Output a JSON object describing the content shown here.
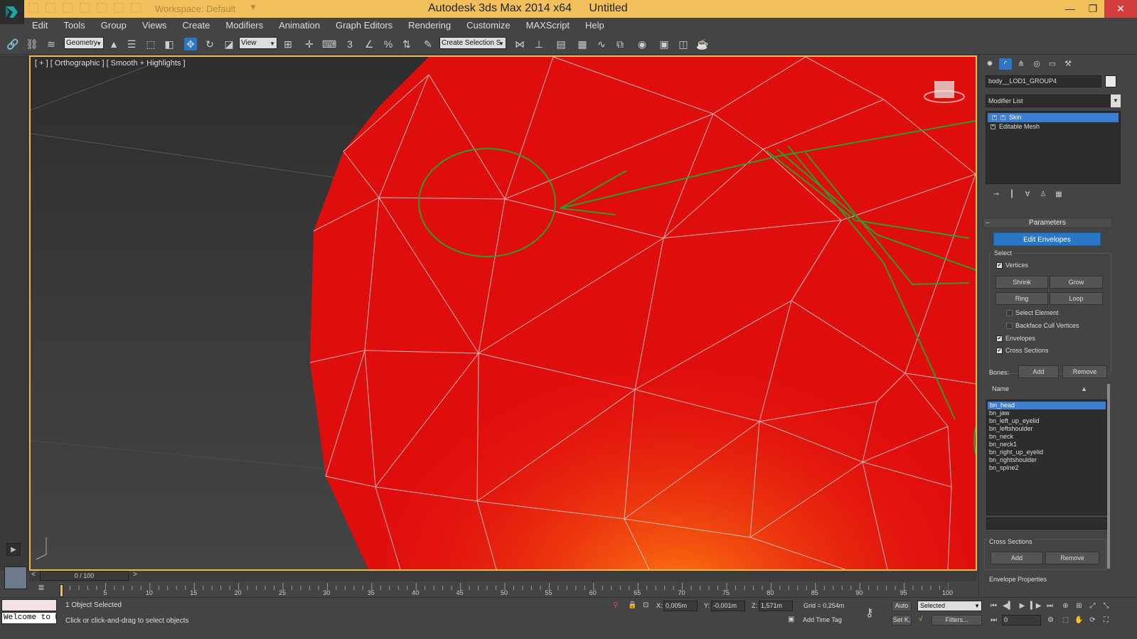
{
  "window": {
    "workspace_label": "Workspace: Default",
    "app_title": "Autodesk 3ds Max  2014 x64",
    "doc_title": "Untitled",
    "minimize": "—",
    "maximize": "❐",
    "close": "✕"
  },
  "menu": [
    "Edit",
    "Tools",
    "Group",
    "Views",
    "Create",
    "Modifiers",
    "Animation",
    "Graph Editors",
    "Rendering",
    "Customize",
    "MAXScript",
    "Help"
  ],
  "toolbar": {
    "filter_select": "Geometry",
    "ref_coord_select": "View",
    "named_selection": "Create Selection S"
  },
  "viewport": {
    "label": "[ + ] [ Orthographic ] [ Smooth + Highlights ]",
    "mesh_color": "#e00d0d",
    "annotation_color": "#2f9a2f"
  },
  "command_panel": {
    "object_name": "body__LOD1_GROUP4",
    "modifier_list": "Modifier List",
    "stack": [
      {
        "label": "Skin",
        "selected": true
      },
      {
        "label": "Editable Mesh",
        "selected": false
      }
    ],
    "parameters": {
      "title": "Parameters",
      "edit_envelopes": "Edit Envelopes",
      "select_group": "Select",
      "vertices": "Vertices",
      "shrink": "Shrink",
      "grow": "Grow",
      "ring": "Ring",
      "loop": "Loop",
      "select_element": "Select Element",
      "backface_cull": "Backface Cull Vertices",
      "envelopes": "Envelopes",
      "cross_sections": "Cross Sections",
      "bones_label": "Bones:",
      "bones_add": "Add",
      "bones_remove": "Remove",
      "list_header": "Name"
    },
    "bones": [
      {
        "name": "bn_head",
        "selected": true
      },
      {
        "name": "bn_jaw",
        "selected": false
      },
      {
        "name": "bn_left_up_eyelid",
        "selected": false
      },
      {
        "name": "bn_leftshoulder",
        "selected": false
      },
      {
        "name": "bn_neck",
        "selected": false
      },
      {
        "name": "bn_neck1",
        "selected": false
      },
      {
        "name": "bn_right_up_eyelid",
        "selected": false
      },
      {
        "name": "bn_rightshoulder",
        "selected": false
      },
      {
        "name": "bn_spine2",
        "selected": false
      }
    ],
    "cross_sections": {
      "title": "Cross Sections",
      "add": "Add",
      "remove": "Remove"
    },
    "envelope_properties": "Envelope Properties"
  },
  "timeline": {
    "frame_display": "0 / 100",
    "prev": "<",
    "next": ">",
    "ticks": [
      "5",
      "10",
      "15",
      "20",
      "25",
      "30",
      "35",
      "40",
      "45",
      "50",
      "55",
      "60",
      "65",
      "70",
      "75",
      "80",
      "85",
      "90",
      "95",
      "100"
    ]
  },
  "status": {
    "welcome": "Welcome to MAXScript.",
    "selection": "1 Object Selected",
    "prompt": "Click or click-and-drag to select objects",
    "x_label": "X:",
    "x_value": "0,005m",
    "y_label": "Y:",
    "y_value": "-0,001m",
    "z_label": "Z:",
    "z_value": "1,571m",
    "grid": "Grid = 0,254m",
    "add_time_tag": "Add Time Tag",
    "auto_key": "Auto",
    "set_key": "Set K.",
    "key_filter_select": "Selected",
    "filters": "Filters...",
    "current_frame": "0"
  }
}
